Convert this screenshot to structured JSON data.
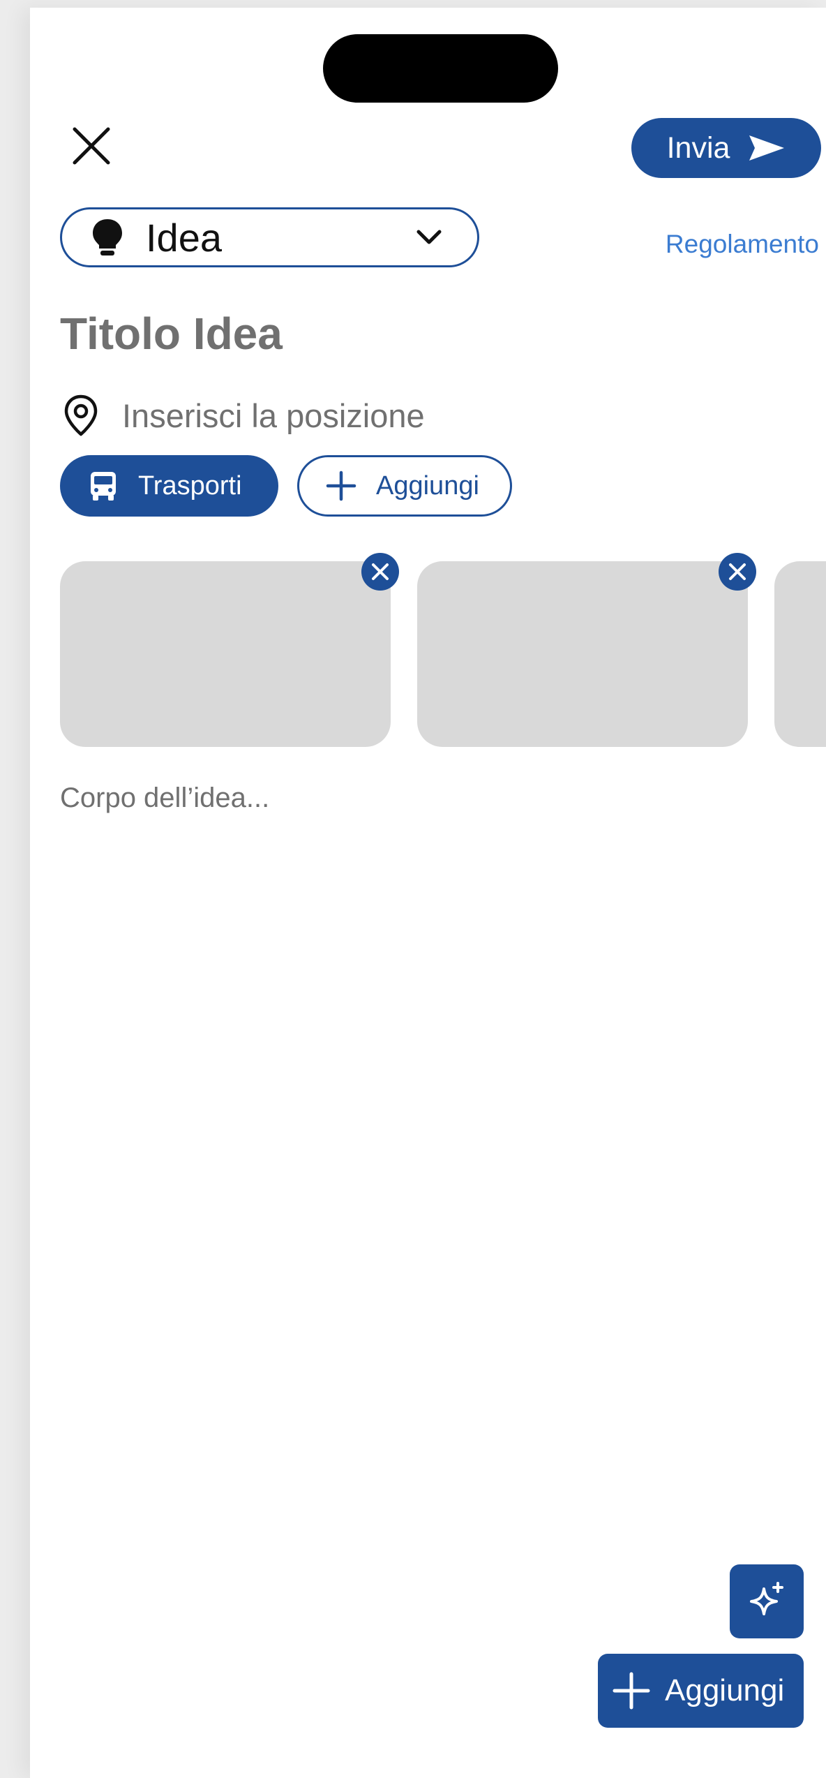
{
  "header": {
    "send_label": "Invia",
    "rules_label": "Regolamento"
  },
  "type_select": {
    "selected": "Idea"
  },
  "form": {
    "title_placeholder": "Titolo Idea",
    "location_placeholder": "Inserisci la posizione",
    "body_placeholder": "Corpo dell’idea..."
  },
  "tags": {
    "selected": [
      {
        "label": "Trasporti",
        "icon": "bus-icon"
      }
    ],
    "add_label": "Aggiungi"
  },
  "attachments": {
    "thumbnail_count_visible": 3
  },
  "actions": {
    "add_label": "Aggiungi",
    "ai_icon": "sparkle-icon"
  },
  "colors": {
    "accent": "#1e4f98",
    "link": "#3b7cd1",
    "placeholder": "#707070",
    "thumbnail": "#d9d9d9"
  }
}
